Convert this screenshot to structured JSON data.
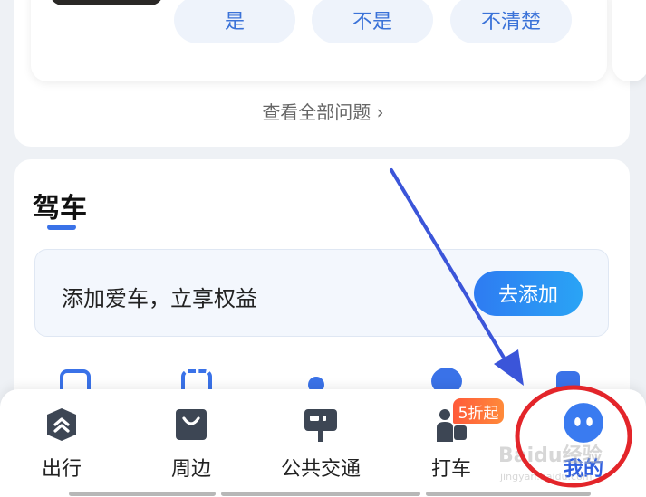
{
  "questions": {
    "answers": [
      "是",
      "不是",
      "不清楚"
    ],
    "see_all": "查看全部问题 ›"
  },
  "drive": {
    "title": "驾车",
    "banner_text": "添加爱车，立享权益",
    "add_button": "去添加"
  },
  "tabbar": {
    "items": [
      {
        "label": "出行",
        "icon": "route-icon",
        "active": false
      },
      {
        "label": "周边",
        "icon": "shopping-bag-icon",
        "active": false
      },
      {
        "label": "公共交通",
        "icon": "bus-stop-sign-icon",
        "active": false
      },
      {
        "label": "打车",
        "icon": "taxi-person-icon",
        "active": false
      },
      {
        "label": "我的",
        "icon": "avatar-icon",
        "active": true
      }
    ],
    "promo_badge": "5折起"
  },
  "watermark": {
    "brand": "Baidu经验",
    "url": "jingyan.baidu.com"
  },
  "colors": {
    "accent": "#2f5fe0",
    "annotation_arrow": "#3b55d9",
    "annotation_circle": "#e3252a",
    "promo": "#ff6a3a"
  }
}
